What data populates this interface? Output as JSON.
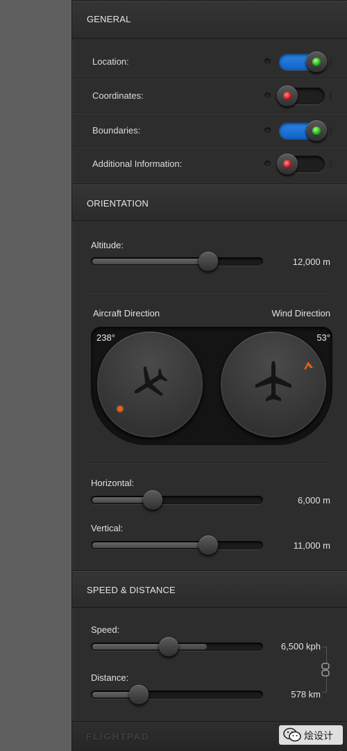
{
  "general": {
    "title": "GENERAL",
    "rows": [
      {
        "label": "Location:",
        "state": "on"
      },
      {
        "label": "Coordinates:",
        "state": "off"
      },
      {
        "label": "Boundaries:",
        "state": "on"
      },
      {
        "label": "Additional Information:",
        "state": "off"
      }
    ]
  },
  "orientation": {
    "title": "ORIENTATION",
    "altitude": {
      "label": "Altitude:",
      "value_text": "12,000 m",
      "fraction": 0.68
    },
    "aircraft_direction": {
      "label": "Aircraft Direction",
      "degrees": "238°"
    },
    "wind_direction": {
      "label": "Wind Direction",
      "degrees": "53°"
    },
    "horizontal": {
      "label": "Horizontal:",
      "value_text": "6,000 m",
      "fraction": 0.36
    },
    "vertical": {
      "label": "Vertical:",
      "value_text": "11,000 m",
      "fraction": 0.68
    }
  },
  "speed_distance": {
    "title": "SPEED & DISTANCE",
    "speed": {
      "label": "Speed:",
      "value_text": "6,500 kph",
      "fraction": 0.45,
      "secondary_fraction": 0.68
    },
    "distance": {
      "label": "Distance:",
      "value_text": "578 km",
      "fraction": 0.28
    }
  },
  "footer": {
    "brand": "FLIGHTPAD"
  },
  "watermark": {
    "text": "烩设计"
  },
  "colors": {
    "accent_on": "#1a6fd4",
    "led_green": "#1fae14",
    "led_red": "#c1121a",
    "wind_marker": "#e8601a"
  },
  "icons": [
    "plane-icon",
    "chain-link-icon",
    "gear-icon",
    "wechat-icon"
  ]
}
